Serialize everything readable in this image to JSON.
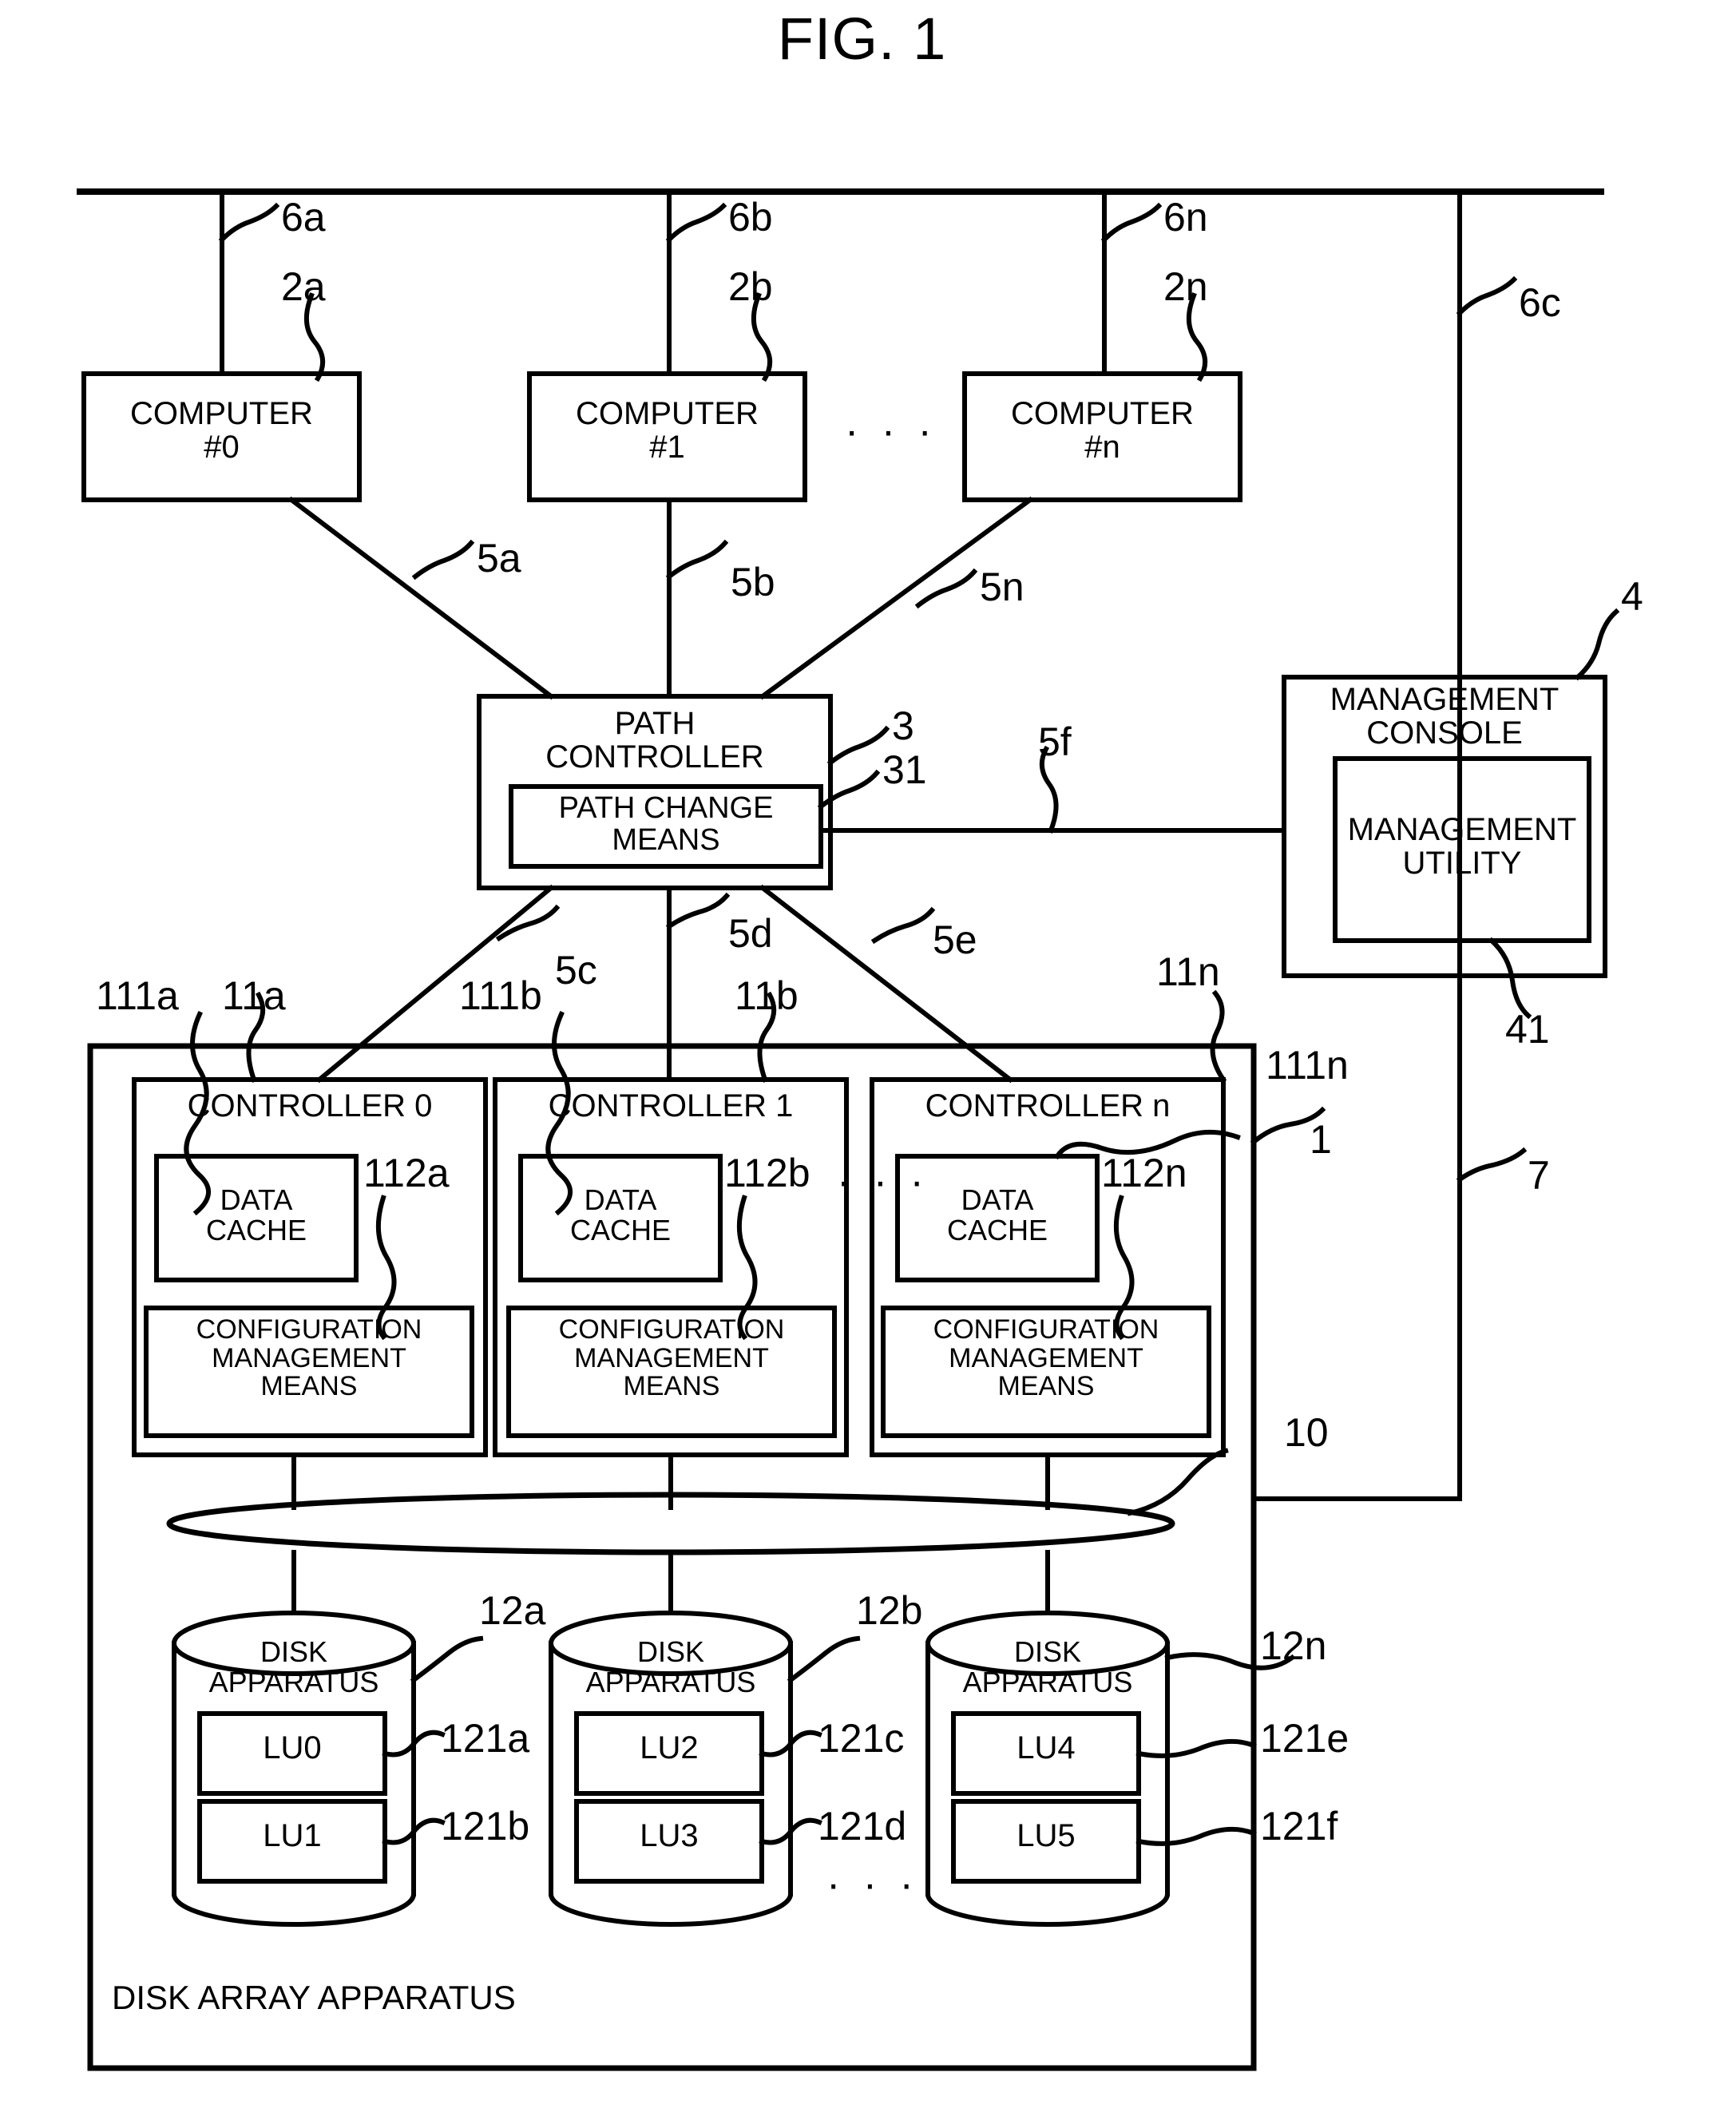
{
  "figure": {
    "title": "FIG. 1",
    "caption": "DISK ARRAY APPARATUS"
  },
  "nodes": {
    "computers": [
      {
        "label": "COMPUTER\n#0",
        "ref_box": "2a",
        "ref_link": "6a"
      },
      {
        "label": "COMPUTER\n#1",
        "ref_box": "2b",
        "ref_link": "6b"
      },
      {
        "label": "COMPUTER\n#n",
        "ref_box": "2n",
        "ref_link": "6n"
      }
    ],
    "computers_ellipsis": "· · ·",
    "path_controller": {
      "label": "PATH\nCONTROLLER",
      "ref": "3",
      "inner": {
        "label": "PATH CHANGE\nMEANS",
        "ref": "31"
      }
    },
    "management_console": {
      "label": "MANAGEMENT\nCONSOLE",
      "ref": "4",
      "inner": {
        "label": "MANAGEMENT\nUTILITY",
        "ref": "41"
      }
    },
    "disk_array": {
      "label": "DISK ARRAY APPARATUS",
      "ref": "1",
      "bus_ref": "10",
      "controllers": [
        {
          "label": "CONTROLLER 0",
          "ref": "11a",
          "cache": {
            "label": "DATA\nCACHE",
            "ref": "111a"
          },
          "config": {
            "label": "CONFIGURATION\nMANAGEMENT\nMEANS",
            "ref": "112a"
          }
        },
        {
          "label": "CONTROLLER 1",
          "ref": "11b",
          "cache": {
            "label": "DATA\nCACHE",
            "ref": "111b"
          },
          "config": {
            "label": "CONFIGURATION\nMANAGEMENT\nMEANS",
            "ref": "112b"
          }
        },
        {
          "label": "CONTROLLER n",
          "ref": "11n",
          "cache": {
            "label": "DATA\nCACHE",
            "ref": "111n"
          },
          "config": {
            "label": "CONFIGURATION\nMANAGEMENT\nMEANS",
            "ref": "112n"
          }
        }
      ],
      "controllers_ellipsis": "· · ·",
      "disks": [
        {
          "label": "DISK\nAPPARATUS",
          "ref": "12a",
          "lus": [
            {
              "label": "LU0",
              "ref": "121a"
            },
            {
              "label": "LU1",
              "ref": "121b"
            }
          ]
        },
        {
          "label": "DISK\nAPPARATUS",
          "ref": "12b",
          "lus": [
            {
              "label": "LU2",
              "ref": "121c"
            },
            {
              "label": "LU3",
              "ref": "121d"
            }
          ]
        },
        {
          "label": "DISK\nAPPARATUS",
          "ref": "12n",
          "lus": [
            {
              "label": "LU4",
              "ref": "121e"
            },
            {
              "label": "LU5",
              "ref": "121f"
            }
          ]
        }
      ],
      "disks_ellipsis": "· · ·"
    }
  },
  "links": {
    "network_bus_taps": [
      "6a",
      "6b",
      "6n",
      "6c"
    ],
    "computer_to_path_controller": [
      "5a",
      "5b",
      "5n"
    ],
    "path_controller_to_controllers": [
      "5c",
      "5d",
      "5e"
    ],
    "path_controller_to_console": "5f",
    "console_to_disk_array": "7"
  },
  "style": {
    "ink": "#000000",
    "paper": "#ffffff"
  }
}
